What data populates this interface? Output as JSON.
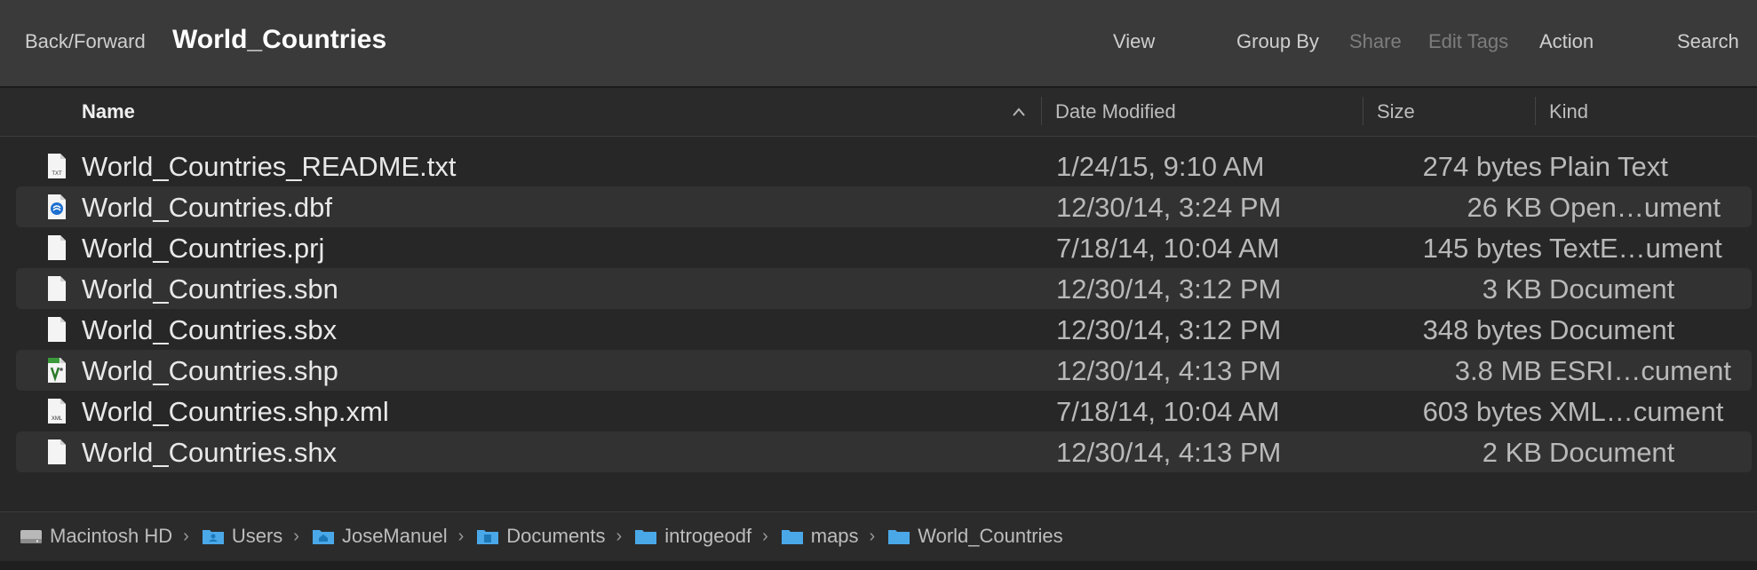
{
  "toolbar": {
    "back_forward": "Back/Forward",
    "title": "World_Countries",
    "view": "View",
    "group_by": "Group By",
    "share": "Share",
    "edit_tags": "Edit Tags",
    "action": "Action",
    "search": "Search"
  },
  "columns": {
    "name": "Name",
    "date_modified": "Date Modified",
    "size": "Size",
    "kind": "Kind"
  },
  "files": [
    {
      "name": "World_Countries_README.txt",
      "date": "1/24/15, 9:10 AM",
      "size": "274 bytes",
      "kind": "Plain Text",
      "icon": "txt-file-icon"
    },
    {
      "name": "World_Countries.dbf",
      "date": "12/30/14, 3:24 PM",
      "size": "26 KB",
      "kind": "Open…ument",
      "icon": "openoffice-file-icon"
    },
    {
      "name": "World_Countries.prj",
      "date": "7/18/14, 10:04 AM",
      "size": "145 bytes",
      "kind": "TextE…ument",
      "icon": "document-file-icon"
    },
    {
      "name": "World_Countries.sbn",
      "date": "12/30/14, 3:12 PM",
      "size": "3 KB",
      "kind": "Document",
      "icon": "document-file-icon"
    },
    {
      "name": "World_Countries.sbx",
      "date": "12/30/14, 3:12 PM",
      "size": "348 bytes",
      "kind": "Document",
      "icon": "document-file-icon"
    },
    {
      "name": "World_Countries.shp",
      "date": "12/30/14, 4:13 PM",
      "size": "3.8 MB",
      "kind": "ESRI…cument",
      "icon": "shapefile-icon"
    },
    {
      "name": "World_Countries.shp.xml",
      "date": "7/18/14, 10:04 AM",
      "size": "603 bytes",
      "kind": "XML…cument",
      "icon": "xml-file-icon"
    },
    {
      "name": "World_Countries.shx",
      "date": "12/30/14, 4:13 PM",
      "size": "2 KB",
      "kind": "Document",
      "icon": "document-file-icon"
    }
  ],
  "path": {
    "drive": "Macintosh HD",
    "users": "Users",
    "user": "JoseManuel",
    "documents": "Documents",
    "introgeodf": "introgeodf",
    "maps": "maps",
    "folder": "World_Countries"
  },
  "colors": {
    "folder": "#4aa8e8",
    "shapefile_badge": "#3a9a3a"
  }
}
